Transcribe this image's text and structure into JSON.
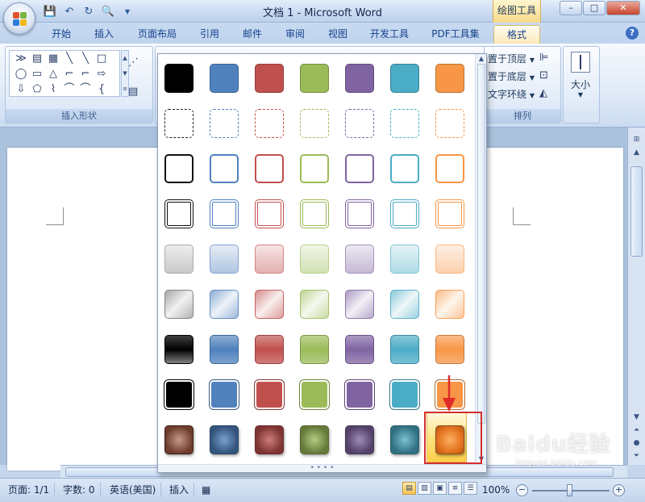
{
  "window": {
    "title": "文档 1 - Microsoft Word",
    "contextual_tab": "绘图工具",
    "controls": {
      "minimize": "–",
      "maximize": "□",
      "close": "✕"
    }
  },
  "qat": {
    "icons": [
      "save-icon",
      "undo-icon",
      "redo-icon",
      "print-preview-icon"
    ]
  },
  "tabs": [
    {
      "label": "开始",
      "active": false
    },
    {
      "label": "插入",
      "active": false
    },
    {
      "label": "页面布局",
      "active": false
    },
    {
      "label": "引用",
      "active": false
    },
    {
      "label": "邮件",
      "active": false
    },
    {
      "label": "审阅",
      "active": false
    },
    {
      "label": "视图",
      "active": false
    },
    {
      "label": "开发工具",
      "active": false
    },
    {
      "label": "PDF工具集",
      "active": false
    },
    {
      "label": "格式",
      "active": true
    }
  ],
  "ribbon": {
    "insert_shapes_label": "插入形状",
    "arrange_label": "排列",
    "bring_to_front": "置于顶层",
    "send_to_back": "置于底层",
    "text_wrap": "文字环绕",
    "size_label": "大小",
    "shapes_glyphs": [
      "≫",
      "▤",
      "▦",
      "╲",
      "╲",
      "□",
      "◯",
      "▭",
      "△",
      "⌐",
      "⌐",
      "⇨",
      "⇩",
      "⬠",
      "⌇",
      "⌒",
      "⌒",
      "{"
    ]
  },
  "gallery": {
    "accent_colors": [
      "#000000",
      "#4f81bd",
      "#c0504d",
      "#9bbb59",
      "#8064a2",
      "#4bacc6",
      "#f79646"
    ],
    "rows": [
      "solid-fill",
      "dashed-outline",
      "thin-outline",
      "double-outline",
      "light-gradient",
      "diagonal-gradient",
      "moderate-gradient",
      "solid-white-border",
      "intense-effect"
    ],
    "selected": {
      "row": 8,
      "column": 6
    }
  },
  "status": {
    "page": "页面: 1/1",
    "words": "字数: 0",
    "language": "英语(美国)",
    "mode": "插入",
    "zoom": "100%"
  },
  "watermark": {
    "text": "Baidu经验",
    "url": "jingyan.baidu.com"
  }
}
